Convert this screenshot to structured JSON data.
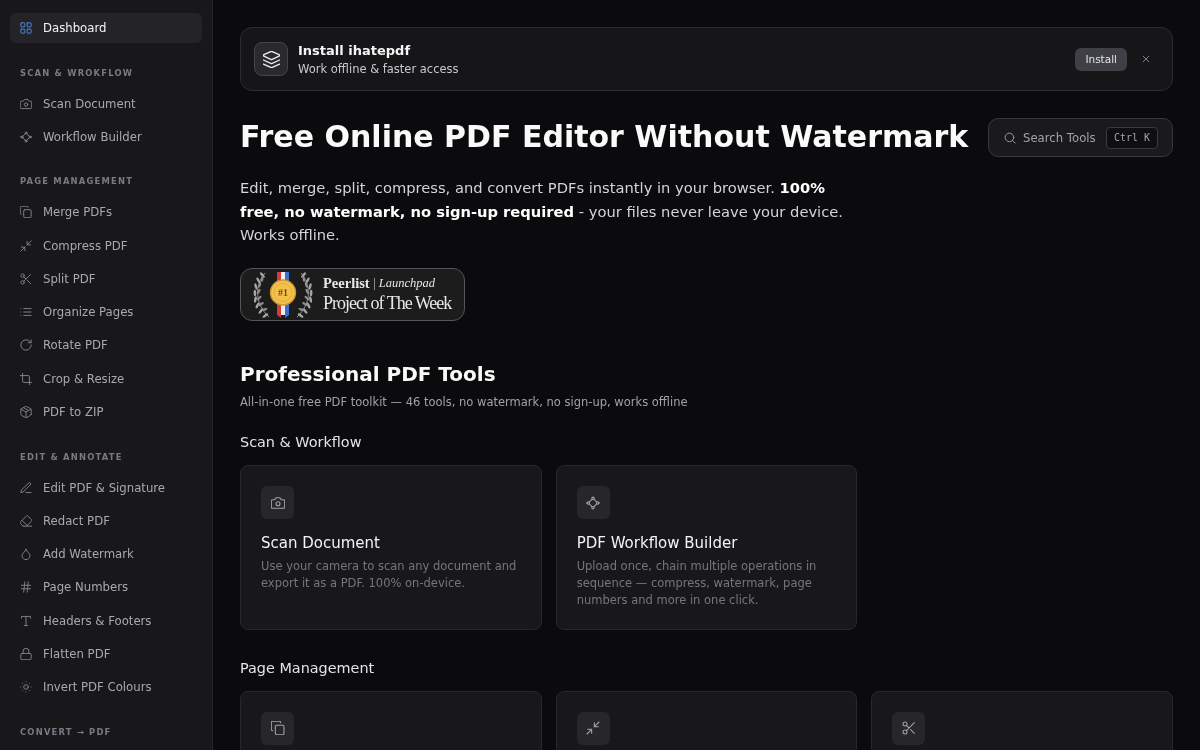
{
  "sidebar": {
    "items": [
      {
        "label": "Dashboard",
        "kind": "grid",
        "selected": true
      }
    ],
    "sections": [
      {
        "title": "SCAN & WROKFLOW",
        "items": [
          {
            "label": "Scan Document",
            "kind": "camera",
            "selected": false
          },
          {
            "label": "Workflow Builder",
            "kind": "nodes",
            "selected": false
          }
        ]
      },
      {
        "title": "PAGE MANAGEMENT",
        "items": [
          {
            "label": "Merge PDFs",
            "kind": "pages",
            "selected": false
          },
          {
            "label": "Compress PDF",
            "kind": "shrink",
            "selected": false
          },
          {
            "label": "Split PDF",
            "kind": "scissors",
            "selected": false
          },
          {
            "label": "Organize Pages",
            "kind": "list",
            "selected": false
          },
          {
            "label": "Rotate PDF",
            "kind": "rotate",
            "selected": false
          },
          {
            "label": "Crop & Resize",
            "kind": "crop",
            "selected": false
          },
          {
            "label": "PDF to ZIP",
            "kind": "box",
            "selected": false
          }
        ]
      },
      {
        "title": "EDIT & ANNOTATE",
        "items": [
          {
            "label": "Edit PDF & Signature",
            "kind": "pencil",
            "selected": false
          },
          {
            "label": "Redact PDF",
            "kind": "eraser",
            "selected": false
          },
          {
            "label": "Add Watermark",
            "kind": "droplet",
            "selected": false
          },
          {
            "label": "Page Numbers",
            "kind": "hash",
            "selected": false
          },
          {
            "label": "Headers & Footers",
            "kind": "letter",
            "selected": false
          },
          {
            "label": "Flatten PDF",
            "kind": "lock",
            "selected": false
          },
          {
            "label": "Invert PDF Colours",
            "kind": "sun",
            "selected": false
          }
        ]
      },
      {
        "title": "CONVERT → PDF"
      }
    ]
  },
  "install_banner": {
    "title": "Install ihatepdf",
    "subtitle": "Work offline & faster access",
    "button": "Install"
  },
  "hero": {
    "title": "Free Online PDF Editor Without Watermark",
    "description": "Edit, merge, split, compress, and convert PDFs instantly in your browser. **100% free, no watermark, no sign-up required** - your files never leave your device. Works offline."
  },
  "search": {
    "label": "Search Tools",
    "shortcut": "Ctrl K"
  },
  "award_badge": {
    "rank": "#1",
    "brand": "Peerlist",
    "program": "Launchpad",
    "title": "Project of The Week"
  },
  "tools": {
    "title": "Professional PDF Tools",
    "subtitle": "All-in-one free PDF toolkit — 46 tools, no watermark, no sign-up, works offline",
    "sections": [
      {
        "title": "Scan & Workflow",
        "cards": [
          {
            "kind": "camera",
            "title": "Scan Document",
            "description": "Use your camera to scan any document and export it as a PDF. 100% on-device."
          },
          {
            "kind": "nodes",
            "title": "PDF Workflow Builder",
            "description": "Upload once, chain multiple operations in sequence — compress, watermark, page numbers and more in one click."
          }
        ]
      },
      {
        "title": "Page Management",
        "cards": [
          {
            "kind": "pages"
          },
          {
            "kind": "shrink"
          },
          {
            "kind": "scissors"
          }
        ]
      }
    ]
  }
}
